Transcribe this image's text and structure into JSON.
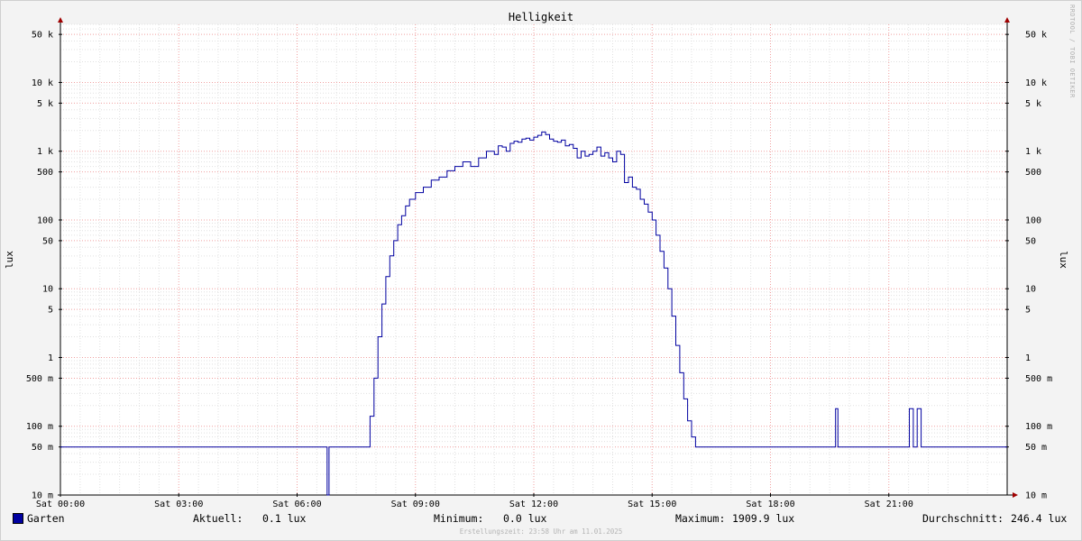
{
  "chart_data": {
    "type": "line",
    "title": "Helligkeit",
    "ylabel": "lux",
    "yscale": "log",
    "ylim": [
      0.01,
      70000
    ],
    "y_ticks": [
      {
        "value": 50000,
        "label": "50 k"
      },
      {
        "value": 10000,
        "label": "10 k"
      },
      {
        "value": 5000,
        "label": "5 k"
      },
      {
        "value": 1000,
        "label": "1 k"
      },
      {
        "value": 500,
        "label": "500"
      },
      {
        "value": 100,
        "label": "100"
      },
      {
        "value": 50,
        "label": "50"
      },
      {
        "value": 10,
        "label": "10"
      },
      {
        "value": 5,
        "label": "5"
      },
      {
        "value": 1,
        "label": "1"
      },
      {
        "value": 0.5,
        "label": "500 m"
      },
      {
        "value": 0.1,
        "label": "100 m"
      },
      {
        "value": 0.05,
        "label": "50 m"
      },
      {
        "value": 0.01,
        "label": "10 m"
      }
    ],
    "x_unit": "hours since Sat 00:00",
    "xlim": [
      0,
      24
    ],
    "x_ticks": [
      {
        "value": 0,
        "label": "Sat 00:00"
      },
      {
        "value": 3,
        "label": "Sat 03:00"
      },
      {
        "value": 6,
        "label": "Sat 06:00"
      },
      {
        "value": 9,
        "label": "Sat 09:00"
      },
      {
        "value": 12,
        "label": "Sat 12:00"
      },
      {
        "value": 15,
        "label": "Sat 15:00"
      },
      {
        "value": 18,
        "label": "Sat 18:00"
      },
      {
        "value": 21,
        "label": "Sat 21:00"
      }
    ],
    "grid": true,
    "series": [
      {
        "name": "Garten",
        "color": "#0000a0",
        "x": [
          0,
          6.75,
          6.76,
          6.8,
          6.81,
          7.8,
          7.85,
          7.95,
          8.05,
          8.15,
          8.25,
          8.35,
          8.45,
          8.55,
          8.65,
          8.75,
          8.85,
          9.0,
          9.2,
          9.4,
          9.6,
          9.8,
          10.0,
          10.2,
          10.4,
          10.6,
          10.8,
          11.0,
          11.1,
          11.2,
          11.3,
          11.4,
          11.5,
          11.6,
          11.7,
          11.8,
          11.9,
          12.0,
          12.1,
          12.2,
          12.3,
          12.4,
          12.5,
          12.6,
          12.7,
          12.8,
          12.9,
          13.0,
          13.1,
          13.2,
          13.3,
          13.4,
          13.5,
          13.6,
          13.7,
          13.8,
          13.9,
          14.0,
          14.1,
          14.2,
          14.3,
          14.4,
          14.5,
          14.6,
          14.7,
          14.8,
          14.9,
          15.0,
          15.1,
          15.2,
          15.3,
          15.4,
          15.5,
          15.6,
          15.7,
          15.8,
          15.9,
          16.0,
          16.1,
          16.2,
          16.3,
          16.4,
          16.5,
          16.6,
          16.7,
          16.8,
          16.9,
          17.0,
          17.1,
          17.2,
          17.3,
          17.4,
          17.5,
          17.6,
          17.65,
          17.7,
          19.6,
          19.65,
          19.7,
          19.71,
          21.5,
          21.52,
          21.6,
          21.62,
          21.7,
          21.72,
          21.8,
          21.82,
          24
        ],
        "y": [
          0.05,
          0.05,
          0.01,
          0.01,
          0.05,
          0.05,
          0.14,
          0.5,
          2,
          6,
          15,
          30,
          50,
          85,
          115,
          160,
          200,
          250,
          300,
          380,
          420,
          520,
          600,
          700,
          600,
          800,
          1000,
          900,
          1200,
          1150,
          1000,
          1300,
          1400,
          1350,
          1500,
          1550,
          1450,
          1600,
          1700,
          1900,
          1750,
          1500,
          1400,
          1350,
          1450,
          1200,
          1250,
          1100,
          800,
          1000,
          850,
          900,
          1000,
          1150,
          850,
          950,
          800,
          700,
          1000,
          900,
          350,
          420,
          300,
          280,
          200,
          170,
          130,
          100,
          60,
          35,
          20,
          10,
          4,
          1.5,
          0.6,
          0.25,
          0.12,
          0.07,
          0.05,
          0.05,
          0.05,
          0.05,
          0.05,
          0.05,
          0.05,
          0.05,
          0.05,
          0.05,
          0.05,
          0.05,
          0.05,
          0.05,
          0.05,
          0.05,
          0.05,
          0.05,
          0.05,
          0.18,
          0.18,
          0.05,
          0.05,
          0.18,
          0.18,
          0.05,
          0.05,
          0.18,
          0.18,
          0.05,
          0.05
        ]
      }
    ]
  },
  "side_text": "RRDTOOL / TOBI OETIKER",
  "legend": {
    "series_name": "Garten",
    "aktuell_label": "Aktuell:",
    "aktuell_value": "0.1 lux",
    "minimum_label": "Minimum:",
    "minimum_value": "0.0 lux",
    "maximum_label": "Maximum:",
    "maximum_value": "1909.9 lux",
    "durchschnitt_label": "Durchschnitt:",
    "durchschnitt_value": "246.4 lux"
  },
  "footer": "Erstellungszeit: 23:58 Uhr am 11.01.2025"
}
